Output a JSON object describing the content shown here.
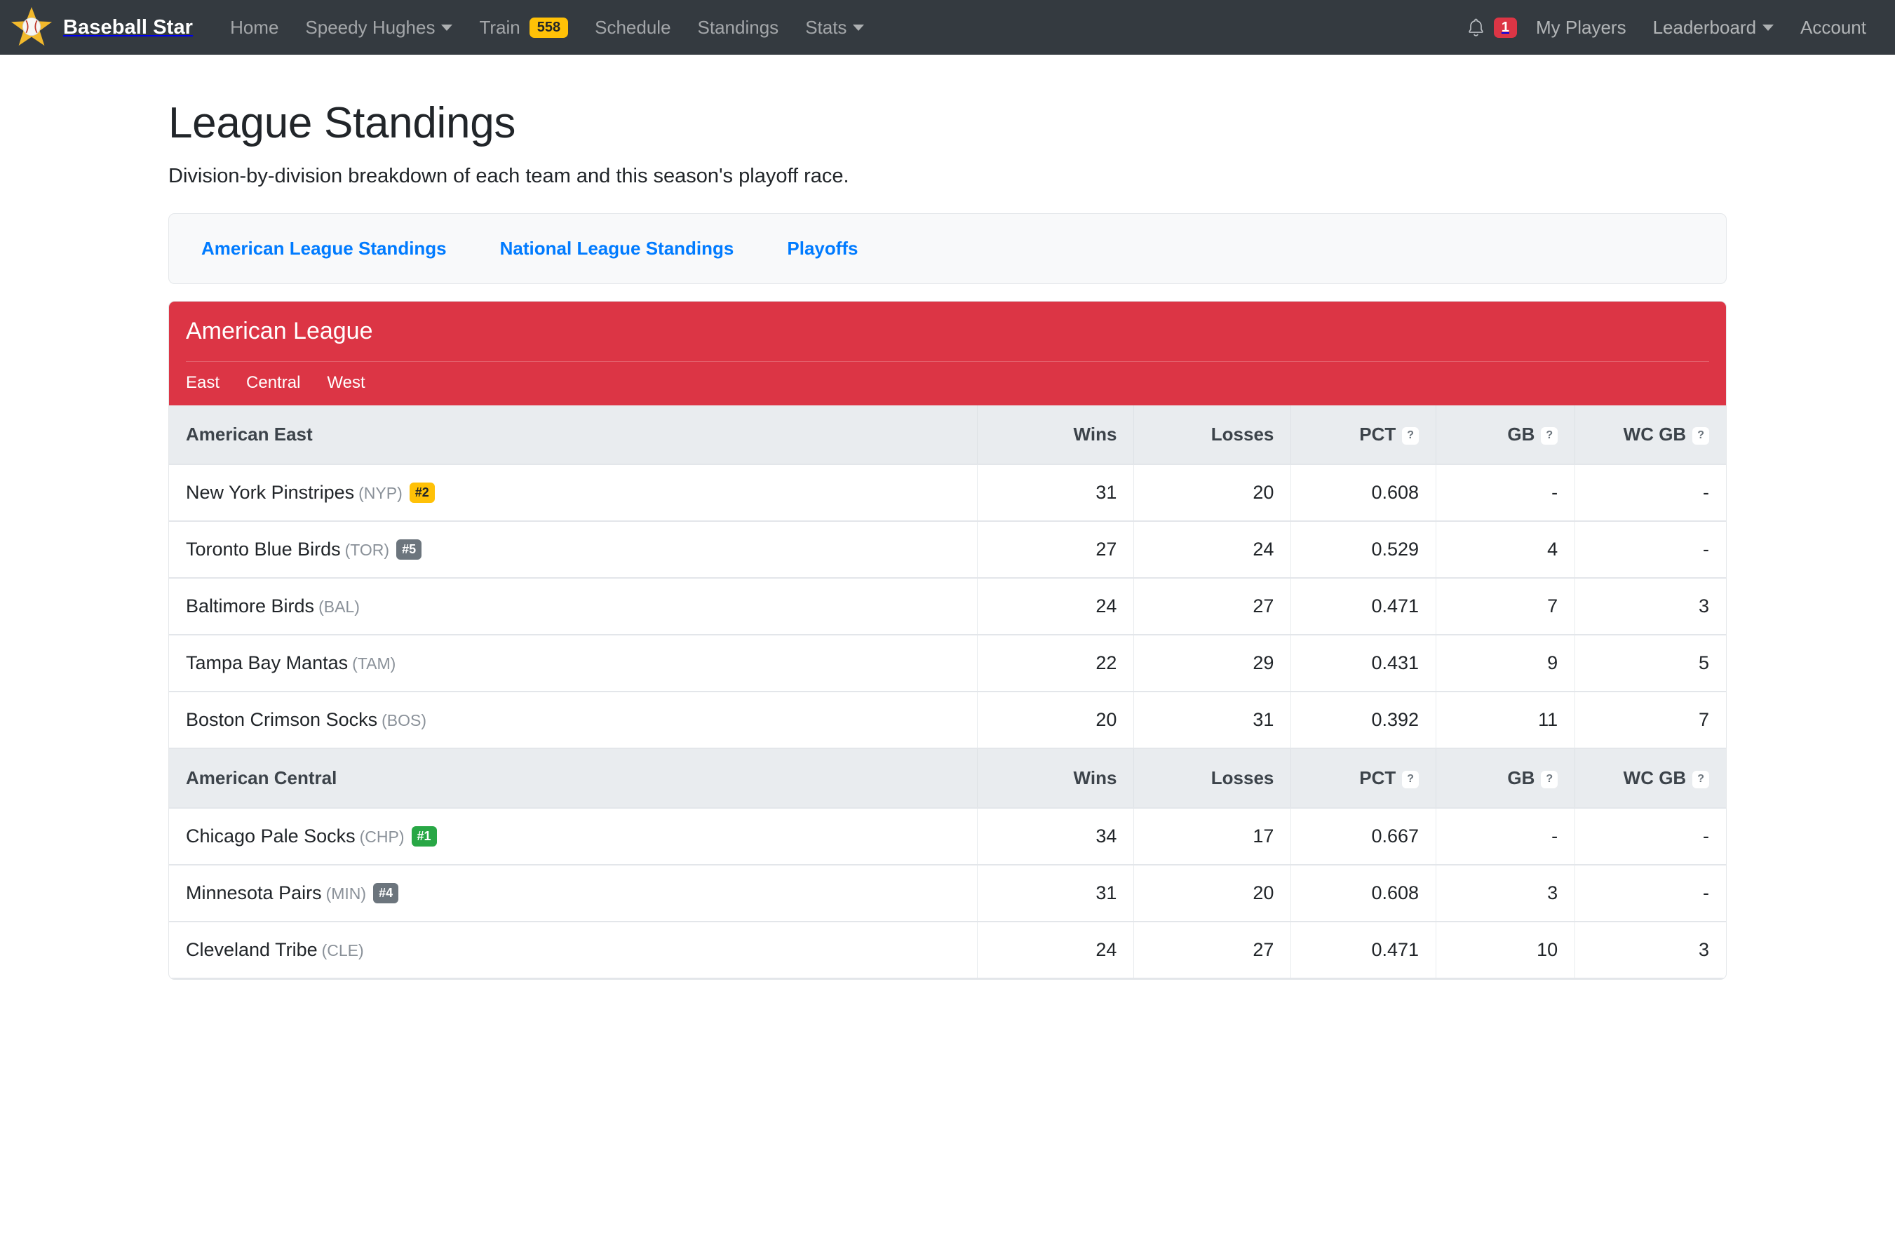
{
  "navbar": {
    "brand": "Baseball Star",
    "logo_icon": "baseball-star-logo",
    "left_items": [
      {
        "label": "Home",
        "icon": null,
        "caret": false
      },
      {
        "label": "Speedy Hughes",
        "icon": null,
        "caret": true
      },
      {
        "label": "Train",
        "icon": null,
        "caret": false,
        "badge": "558"
      },
      {
        "label": "Schedule",
        "icon": null,
        "caret": false
      },
      {
        "label": "Standings",
        "icon": null,
        "caret": false
      },
      {
        "label": "Stats",
        "icon": null,
        "caret": true
      }
    ],
    "right_items": [
      {
        "label": "My Players",
        "caret": false
      },
      {
        "label": "Leaderboard",
        "caret": true
      },
      {
        "label": "Account",
        "caret": false
      }
    ],
    "notifications": {
      "icon": "bell-icon",
      "count": "1"
    },
    "colors": {
      "bar": "#343a40",
      "train_badge": "#ffc107",
      "notif_badge": "#dc3545"
    }
  },
  "page": {
    "title": "League Standings",
    "subtitle": "Division-by-division breakdown of each team and this season's playoff race."
  },
  "quick_links": [
    "American League Standings",
    "National League Standings",
    "Playoffs"
  ],
  "league": {
    "name": "American League",
    "header_color": "#dc3545",
    "divisions_nav": [
      "East",
      "Central",
      "West"
    ]
  },
  "columns": {
    "wins": "Wins",
    "losses": "Losses",
    "pct": "PCT",
    "gb": "GB",
    "wc_gb": "WC GB",
    "help_glyph": "?"
  },
  "divisions": [
    {
      "name": "American East",
      "teams": [
        {
          "name": "New York Pinstripes",
          "abbr": "(NYP)",
          "rank_badge": "#2",
          "rank_style": "gold",
          "wins": "31",
          "losses": "20",
          "pct": "0.608",
          "gb": "-",
          "wc_gb": "-"
        },
        {
          "name": "Toronto Blue Birds",
          "abbr": "(TOR)",
          "rank_badge": "#5",
          "rank_style": "gray",
          "wins": "27",
          "losses": "24",
          "pct": "0.529",
          "gb": "4",
          "wc_gb": "-"
        },
        {
          "name": "Baltimore Birds",
          "abbr": "(BAL)",
          "rank_badge": null,
          "rank_style": null,
          "wins": "24",
          "losses": "27",
          "pct": "0.471",
          "gb": "7",
          "wc_gb": "3"
        },
        {
          "name": "Tampa Bay Mantas",
          "abbr": "(TAM)",
          "rank_badge": null,
          "rank_style": null,
          "wins": "22",
          "losses": "29",
          "pct": "0.431",
          "gb": "9",
          "wc_gb": "5"
        },
        {
          "name": "Boston Crimson Socks",
          "abbr": "(BOS)",
          "rank_badge": null,
          "rank_style": null,
          "wins": "20",
          "losses": "31",
          "pct": "0.392",
          "gb": "11",
          "wc_gb": "7"
        }
      ]
    },
    {
      "name": "American Central",
      "teams": [
        {
          "name": "Chicago Pale Socks",
          "abbr": "(CHP)",
          "rank_badge": "#1",
          "rank_style": "green",
          "wins": "34",
          "losses": "17",
          "pct": "0.667",
          "gb": "-",
          "wc_gb": "-"
        },
        {
          "name": "Minnesota Pairs",
          "abbr": "(MIN)",
          "rank_badge": "#4",
          "rank_style": "gray",
          "wins": "31",
          "losses": "20",
          "pct": "0.608",
          "gb": "3",
          "wc_gb": "-"
        },
        {
          "name": "Cleveland Tribe",
          "abbr": "(CLE)",
          "rank_badge": null,
          "rank_style": null,
          "wins": "24",
          "losses": "27",
          "pct": "0.471",
          "gb": "10",
          "wc_gb": "3"
        }
      ]
    }
  ]
}
